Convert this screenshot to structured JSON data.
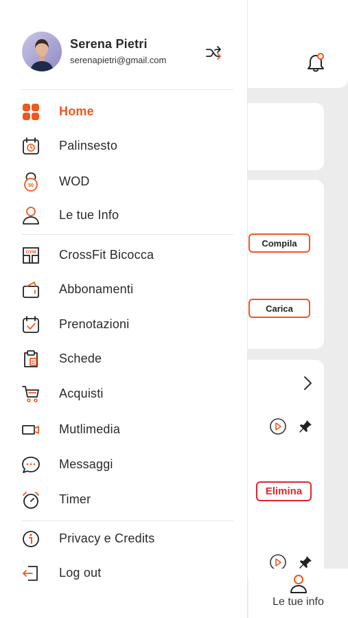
{
  "colors": {
    "accent": "#f0561d",
    "danger": "#e1252b",
    "text": "#2a2a2a",
    "background": "#ececec"
  },
  "drawer": {
    "user": {
      "name": "Serena Pietri",
      "email": "serenapietri@gmail.com"
    },
    "switch_icon": "shuffle-icon",
    "menu": [
      {
        "label": "Home",
        "icon": "grid-icon",
        "active": true
      },
      {
        "label": "Palinsesto",
        "icon": "calendar-clock-icon"
      },
      {
        "label": "WOD",
        "icon": "kettlebell-icon"
      },
      {
        "label": "Le tue Info",
        "icon": "user-icon"
      },
      {
        "label": "CrossFit Bicocca",
        "icon": "gym-icon"
      },
      {
        "label": "Abbonamenti",
        "icon": "wallet-icon"
      },
      {
        "label": "Prenotazioni",
        "icon": "calendar-check-icon"
      },
      {
        "label": "Schede",
        "icon": "clipboard-icon"
      },
      {
        "label": "Acquisti",
        "icon": "cart-icon"
      },
      {
        "label": "Mutlimedia",
        "icon": "video-camera-icon"
      },
      {
        "label": "Messaggi",
        "icon": "chat-bubble-icon"
      },
      {
        "label": "Timer",
        "icon": "timer-icon"
      },
      {
        "label": "Privacy e Credits",
        "icon": "info-icon"
      },
      {
        "label": "Log out",
        "icon": "logout-icon"
      }
    ]
  },
  "background": {
    "compila_label": "Compila",
    "carica_label": "Carica",
    "elimina_label": "Elimina",
    "bottom_tab_label": "Le tue info"
  }
}
